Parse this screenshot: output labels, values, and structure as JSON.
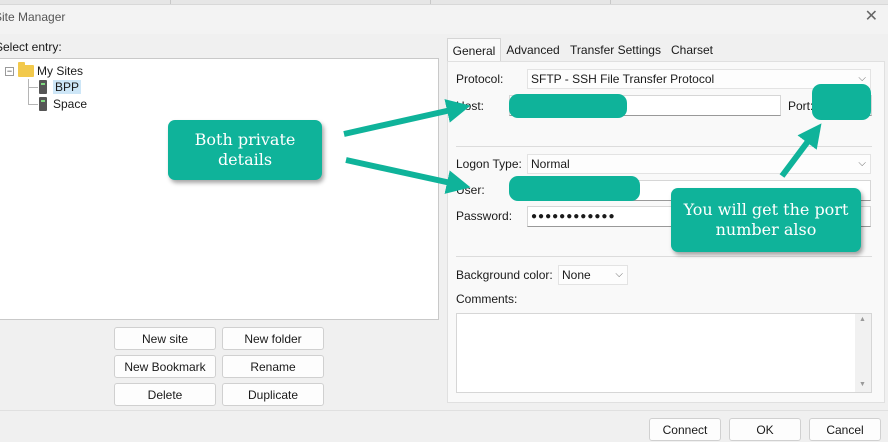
{
  "window": {
    "title": "Site Manager"
  },
  "left": {
    "select_label": "Select entry:",
    "tree": {
      "root": "My Sites",
      "children": [
        "BPP",
        "Space"
      ]
    },
    "buttons": {
      "new_site": "New site",
      "new_folder": "New folder",
      "new_bookmark": "New Bookmark",
      "rename": "Rename",
      "delete": "Delete",
      "duplicate": "Duplicate"
    }
  },
  "tabs": [
    "General",
    "Advanced",
    "Transfer Settings",
    "Charset"
  ],
  "general": {
    "protocol_label": "Protocol:",
    "protocol_value": "SFTP - SSH File Transfer Protocol",
    "host_label": "Host:",
    "port_label": "Port:",
    "logon_label": "Logon Type:",
    "logon_value": "Normal",
    "user_label": "User:",
    "password_label": "Password:",
    "password_mask": "●●●●●●●●●●●●",
    "bg_color_label": "Background color:",
    "bg_color_value": "None",
    "comments_label": "Comments:"
  },
  "footer": {
    "connect": "Connect",
    "ok": "OK",
    "cancel": "Cancel"
  },
  "annotations": {
    "private": "Both private details",
    "port": "You will get the port number also",
    "accent_color": "#0fb39a"
  }
}
